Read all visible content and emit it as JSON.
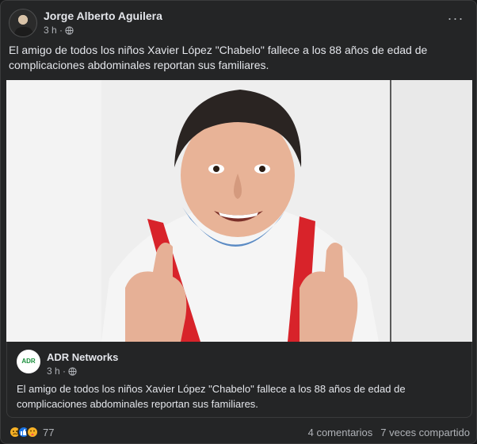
{
  "post": {
    "author": "Jorge Alberto Aguilera",
    "time": "3 h ·",
    "more_label": "···",
    "text": "El amigo de todos los niños Xavier López \"Chabelo\" fallece a los 88 años de edad de complicaciones abdominales reportan sus familiares."
  },
  "shared_post": {
    "author": "ADR Networks",
    "logo_text": "ADR",
    "time": "3 h ·",
    "text": "El amigo de todos los niños Xavier López \"Chabelo\" fallece a los 88 años de edad de complicaciones abdominales reportan sus familiares."
  },
  "footer": {
    "reaction_count": "77",
    "comments": "4 comentarios",
    "shares": "7 veces compartido"
  },
  "icons": [
    "sad-reaction-icon",
    "like-reaction-icon",
    "care-reaction-icon",
    "globe-icon",
    "more-options-icon"
  ]
}
